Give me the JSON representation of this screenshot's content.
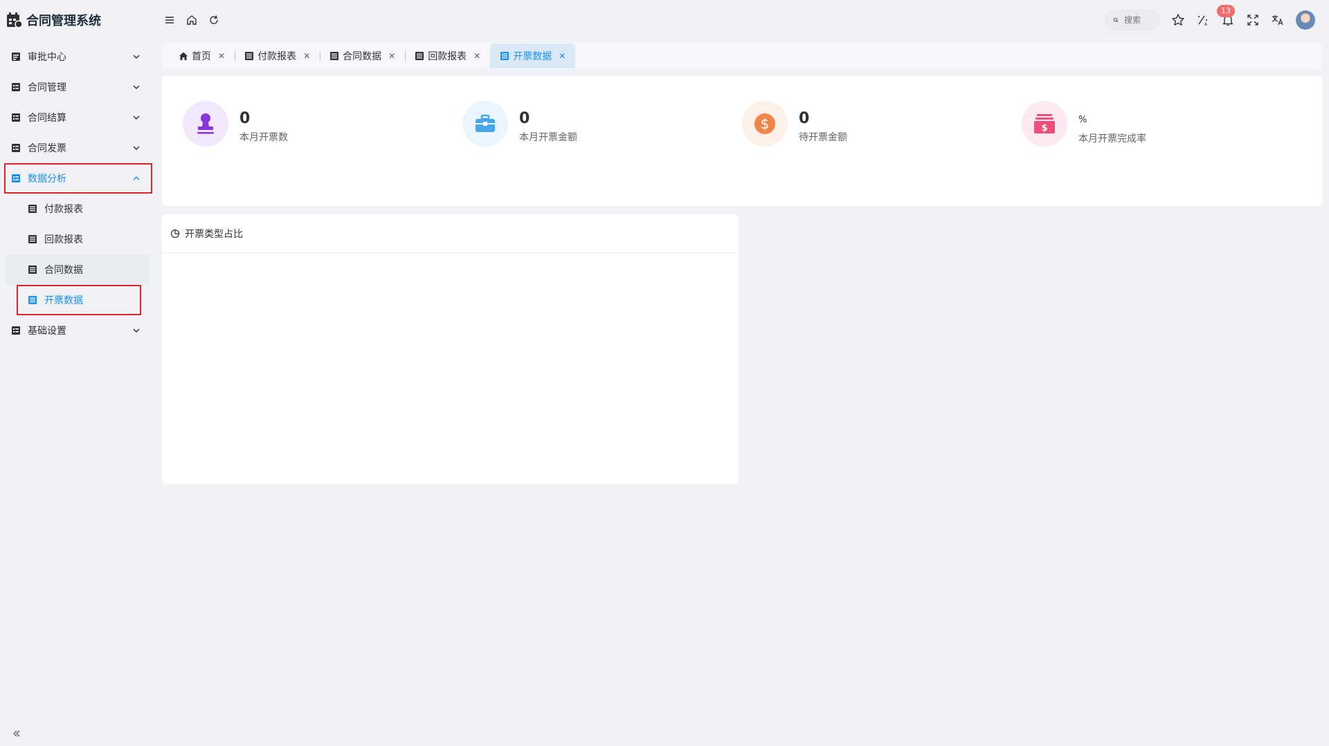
{
  "app": {
    "title": "合同管理系统"
  },
  "sidebar": {
    "items": [
      {
        "label": "审批中心"
      },
      {
        "label": "合同管理"
      },
      {
        "label": "合同结算"
      },
      {
        "label": "合同发票"
      },
      {
        "label": "数据分析",
        "expanded": true,
        "children": [
          {
            "label": "付款报表"
          },
          {
            "label": "回款报表"
          },
          {
            "label": "合同数据"
          },
          {
            "label": "开票数据",
            "selected": true
          }
        ]
      },
      {
        "label": "基础设置"
      }
    ]
  },
  "header": {
    "search_placeholder": "搜索",
    "notification_count": "13"
  },
  "tabs": [
    {
      "label": "首页",
      "icon": "home-icon"
    },
    {
      "label": "付款报表",
      "icon": "list-icon"
    },
    {
      "label": "合同数据",
      "icon": "list-icon"
    },
    {
      "label": "回款报表",
      "icon": "list-icon"
    },
    {
      "label": "开票数据",
      "icon": "list-icon",
      "active": true
    }
  ],
  "stats": [
    {
      "value": "0",
      "label": "本月开票数",
      "color": "#8a35d9",
      "bg": "#f1e9fb"
    },
    {
      "value": "0",
      "label": "本月开票金额",
      "color": "#45a6e8",
      "bg": "#eaf5fd"
    },
    {
      "value": "0",
      "label": "待开票金额",
      "color": "#f2864a",
      "bg": "#fdf0e8"
    },
    {
      "value": "%",
      "label": "本月开票完成率",
      "color": "#ec4f7c",
      "bg": "#fdeaf0"
    }
  ],
  "chart": {
    "title": "开票类型占比"
  },
  "colors": {
    "accent": "#1890ff",
    "highlight_box": "#e0242b",
    "badge": "#f56c6c"
  }
}
